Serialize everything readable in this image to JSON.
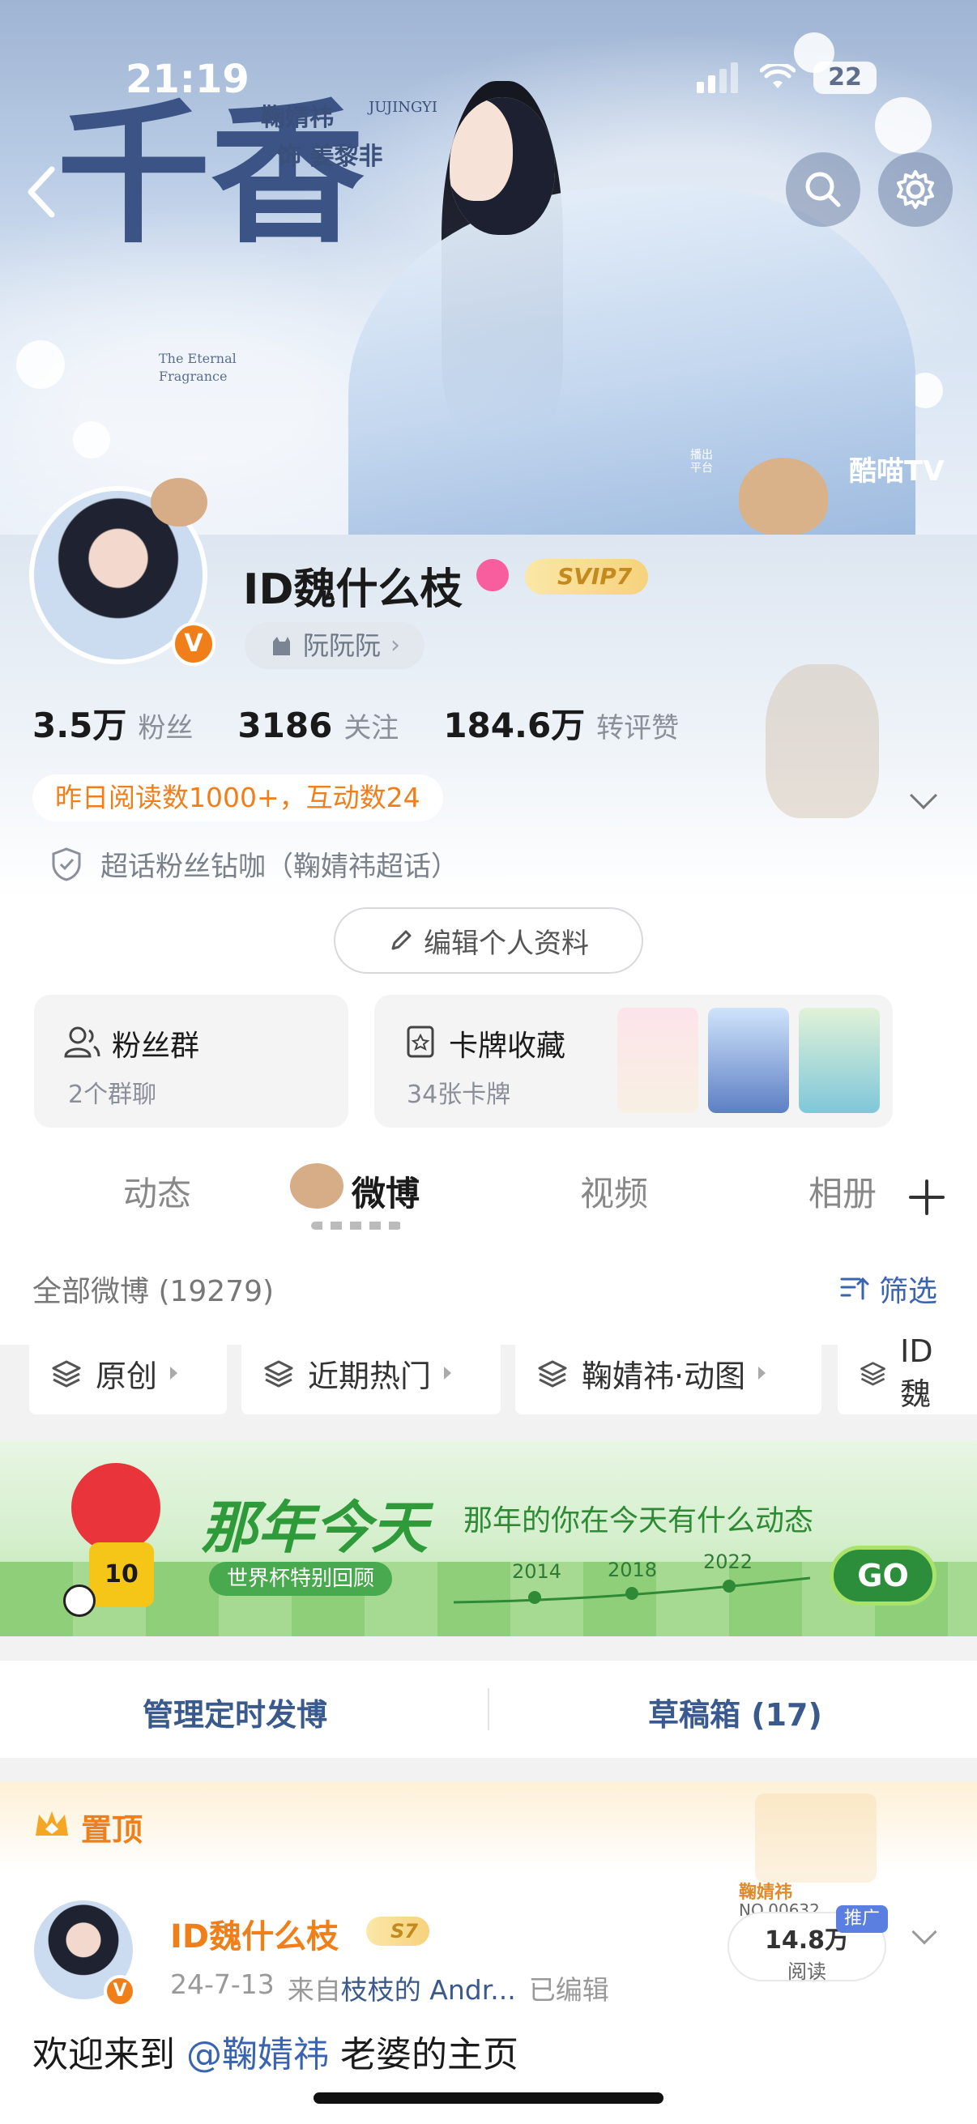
{
  "status_bar": {
    "time": "21:19",
    "battery": "22"
  },
  "banner": {
    "actor_line1": "鞠婧祎",
    "actor_line2": "饰 姜黎非",
    "actor_en": "JUJINGYI",
    "title_glyphs": "千香",
    "subtitle_en": "The Eternal Fragrance",
    "platform_label": "播出平台",
    "platform_name": "酷喵TV"
  },
  "profile": {
    "name": "ID魏什么枝",
    "vip_badge": "SVIP7",
    "tag": "阮阮阮",
    "stats": [
      {
        "value": "3.5万",
        "label": "粉丝"
      },
      {
        "value": "3186",
        "label": "关注"
      },
      {
        "value": "184.6万",
        "label": "转评赞"
      }
    ],
    "read_summary": "昨日阅读数1000+，互动数24",
    "supertopic": "超话粉丝钻咖（鞠婧祎超话）",
    "edit_button": "编辑个人资料"
  },
  "cards": {
    "fans_group": {
      "title": "粉丝群",
      "subtitle": "2个群聊"
    },
    "card_collection": {
      "title": "卡牌收藏",
      "subtitle": "34张卡牌"
    }
  },
  "tabs": [
    {
      "label": "动态"
    },
    {
      "label": "微博"
    },
    {
      "label": "视频"
    },
    {
      "label": "相册"
    }
  ],
  "feed": {
    "all_label": "全部微博 (19279)",
    "filter_label": "筛选",
    "chips": [
      "原创",
      "近期热门",
      "鞠婧祎·动图",
      "ID魏"
    ]
  },
  "ad": {
    "title": "那年今天",
    "subtitle": "那年的你在今天有什么动态",
    "pill": "世界杯特别回顾",
    "years": [
      "2014",
      "2018",
      "2022"
    ],
    "go": "GO"
  },
  "manage": {
    "scheduled": "管理定时发博",
    "drafts": "草稿箱 (17)"
  },
  "post": {
    "pinned_label": "置顶",
    "author": "ID魏什么枝",
    "level_badge": "S7",
    "date": "24-7-13",
    "from_prefix": "来自",
    "source": "枝枝的 Andr...",
    "edited": "已编辑",
    "views_value": "14.8万",
    "views_label": "阅读",
    "promo_badge": "推广",
    "promo_name": "鞠婧祎",
    "promo_no": "NO.00632",
    "text_before": "欢迎来到",
    "mention": "@鞠婧祎",
    "text_after": "老婆的主页"
  }
}
